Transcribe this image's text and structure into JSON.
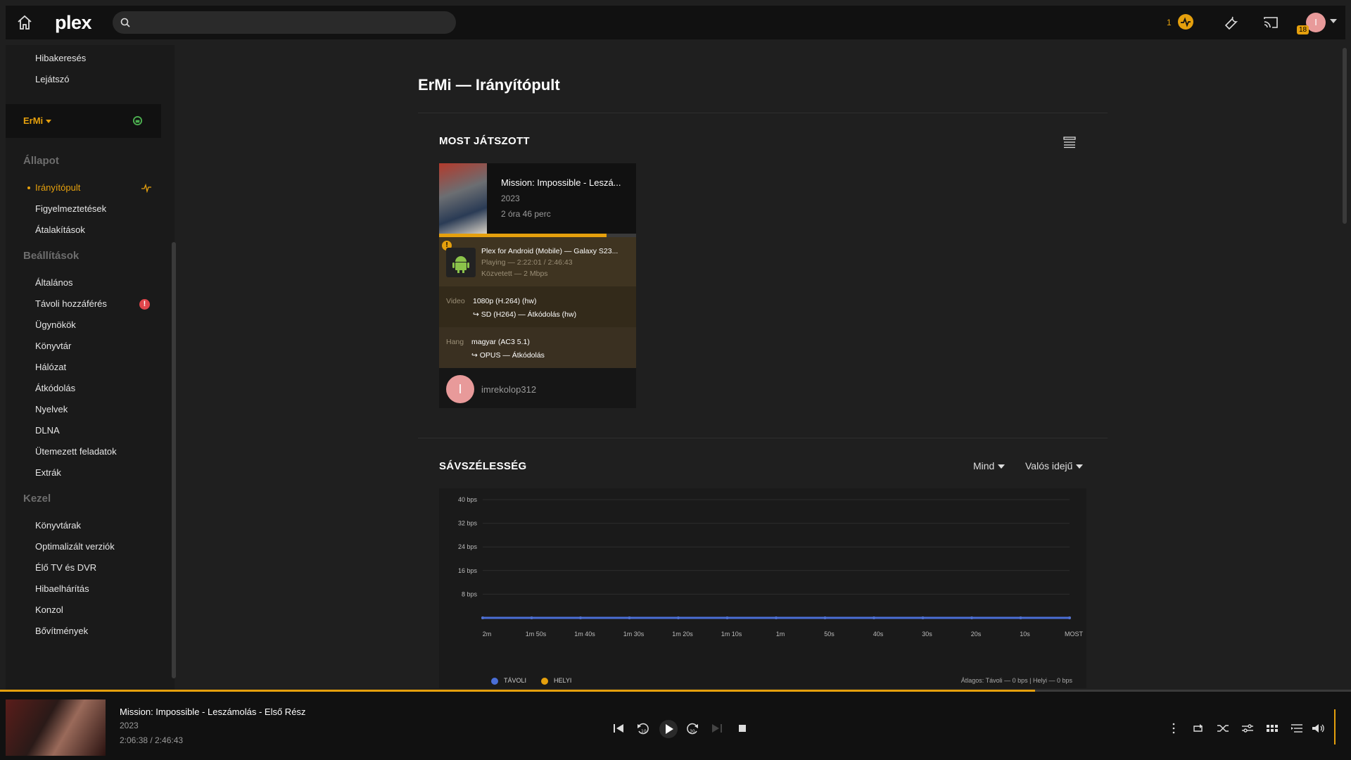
{
  "topbar": {
    "logo": "plex",
    "search_placeholder": "",
    "activity_count": "1",
    "avatar_letter": "I",
    "avatar_badge": "18"
  },
  "sidebar": {
    "top_items": [
      "Hibakeresés",
      "Lejátszó"
    ],
    "server_name": "ErMi",
    "sections": [
      {
        "heading": "Állapot",
        "items": [
          "Irányítópult",
          "Figyelmeztetések",
          "Átalakítások"
        ]
      },
      {
        "heading": "Beállítások",
        "items": [
          "Általános",
          "Távoli hozzáférés",
          "Ügynökök",
          "Könyvtár",
          "Hálózat",
          "Átkódolás",
          "Nyelvek",
          "DLNA",
          "Ütemezett feladatok",
          "Extrák"
        ]
      },
      {
        "heading": "Kezel",
        "items": [
          "Könyvtárak",
          "Optimalizált verziók",
          "Élő TV és DVR",
          "Hibaelhárítás",
          "Konzol",
          "Bővítmények"
        ]
      }
    ],
    "remote_access_error": "!"
  },
  "main": {
    "title": "ErMi — Irányítópult",
    "now_playing": {
      "heading": "MOST JÁTSZOTT",
      "title": "Mission: Impossible - Leszá...",
      "year": "2023",
      "duration": "2 óra 46 perc",
      "progress": 0.85,
      "warning": "!",
      "device": "Plex for Android (Mobile)  —  Galaxy S23...",
      "state": "Playing — 2:22:01 / 2:46:43",
      "bandwidth": "Közvetett — 2 Mbps",
      "video_label": "Video",
      "video_main": "1080p (H.264) (hw)",
      "video_sub": "↪  SD (H264) — Átkódolás (hw)",
      "audio_label": "Hang",
      "audio_main": "magyar (AC3 5.1)",
      "audio_sub": "↪  OPUS — Átkódolás",
      "user_letter": "I",
      "user": "imrekolop312"
    },
    "bandwidth": {
      "heading": "SÁVSZÉLESSÉG",
      "filter_all": "Mind",
      "filter_time": "Valós idejű",
      "legend_remote": "TÁVOLI",
      "legend_local": "HELYI",
      "average": "Átlagos: Távoli — 0 bps | Helyi — 0 bps"
    }
  },
  "chart_data": {
    "type": "line",
    "title": "",
    "x": [
      "2m",
      "1m 50s",
      "1m 40s",
      "1m 30s",
      "1m 20s",
      "1m 10s",
      "1m",
      "50s",
      "40s",
      "30s",
      "20s",
      "10s",
      "MOST"
    ],
    "yticks": [
      "8 bps",
      "16 bps",
      "24 bps",
      "32 bps",
      "40 bps"
    ],
    "ylim": [
      0,
      40
    ],
    "series": [
      {
        "name": "TÁVOLI",
        "color": "#4a6ed6",
        "values": [
          0,
          0,
          0,
          0,
          0,
          0,
          0,
          0,
          0,
          0,
          0,
          0,
          0
        ]
      },
      {
        "name": "HELYI",
        "color": "#e5a00d",
        "values": [
          0,
          0,
          0,
          0,
          0,
          0,
          0,
          0,
          0,
          0,
          0,
          0,
          0
        ]
      }
    ],
    "grid": true,
    "legend": "bottom-left"
  },
  "player": {
    "title": "Mission: Impossible - Leszámolás - Első Rész",
    "year": "2023",
    "time": "2:06:38 / 2:46:43",
    "progress": 0.766
  },
  "colors": {
    "accent": "#e5a00d",
    "remote_series": "#4a6ed6",
    "error": "#e0464b"
  }
}
